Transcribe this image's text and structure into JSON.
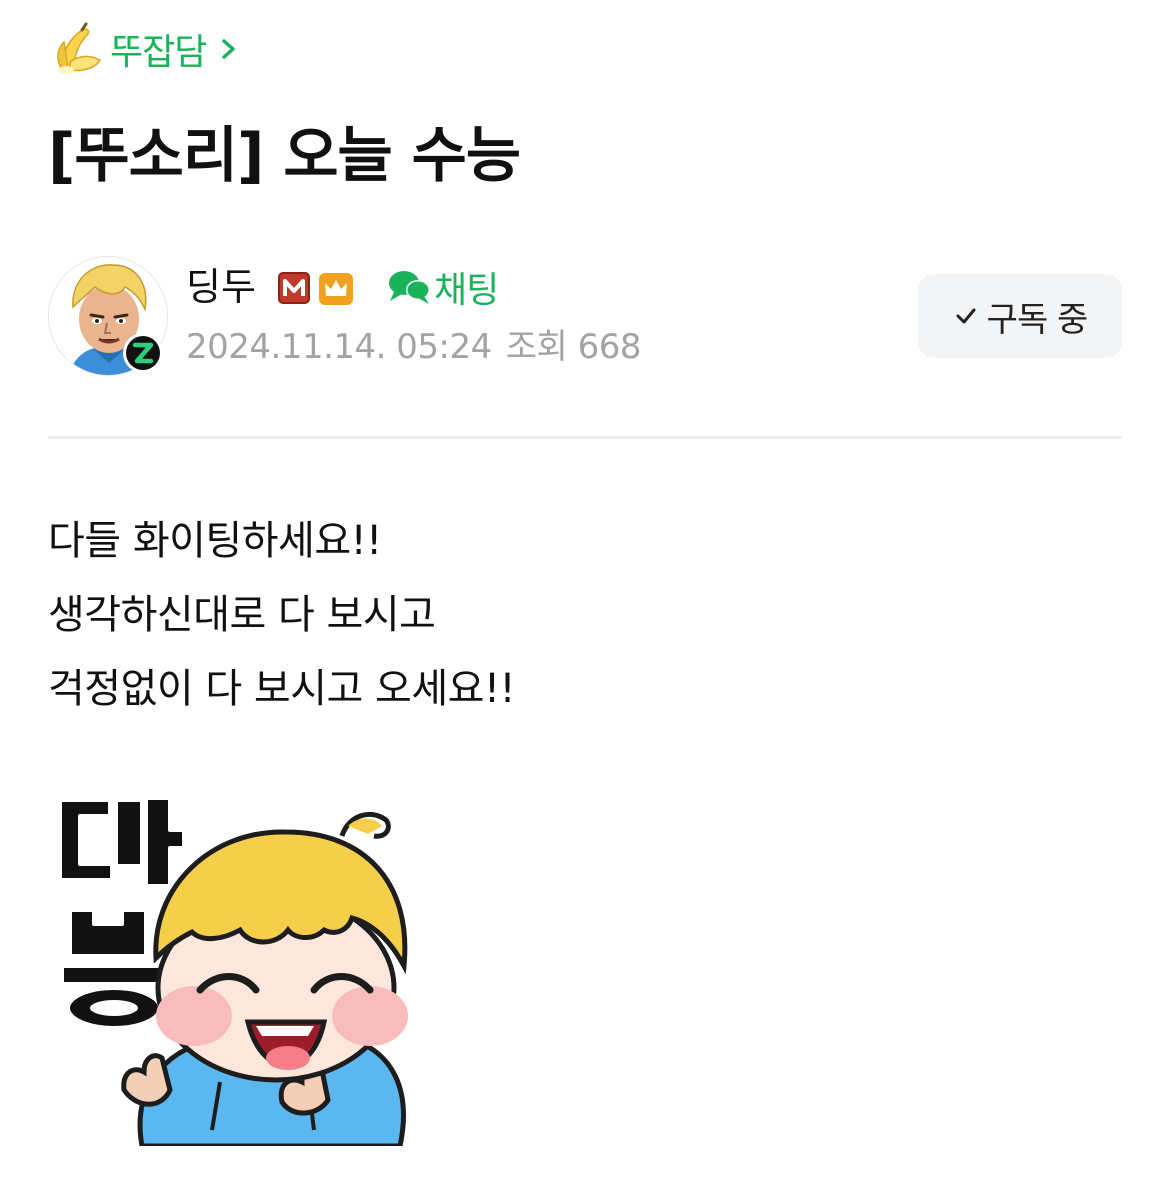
{
  "board": {
    "icon": "banana-icon",
    "name": "뚜잡담",
    "chevron": "chevron-right-icon",
    "accent_color": "#1bb35a"
  },
  "post": {
    "title": "[뚜소리] 오늘 수능",
    "author": {
      "name": "딩두",
      "badges": [
        "manager-badge-icon",
        "crown-badge-icon"
      ],
      "avatar_badge": "zep-badge-icon"
    },
    "chat_label": "채팅",
    "date": "2024.11.14. 05:24",
    "views_label": "조회 668",
    "subscribe_label": "구독 중",
    "body_lines": [
      "다들 화이팅하세요!!",
      "생각하신대로 다 보시고",
      "걱정없이 다 보시고 오세요!!"
    ],
    "sticker": {
      "text": "따봉",
      "description": "thumbs-up-sticker"
    }
  }
}
